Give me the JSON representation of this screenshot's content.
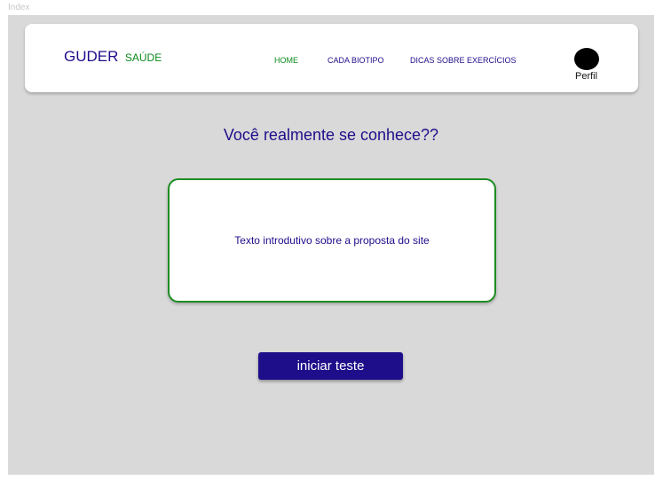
{
  "frame": {
    "label": "Index"
  },
  "header": {
    "brand": {
      "main": "GUDER",
      "sub": "SAÚDE"
    },
    "nav": [
      {
        "label": "HOME",
        "active": true
      },
      {
        "label": "CADA BIOTIPO",
        "active": false
      },
      {
        "label": "DICAS SOBRE EXERCÍCIOS",
        "active": false
      }
    ],
    "profile": {
      "label": "Perfil",
      "icon": "avatar-circle"
    }
  },
  "main": {
    "title": "Você realmente se conhece??",
    "intro": "Texto introdutivo sobre a proposta do site",
    "button_label": "iniciar teste"
  },
  "colors": {
    "primary": "#1f0e8a",
    "accent_green": "#0b8a1c",
    "background": "#d9d9d9",
    "card": "#ffffff"
  }
}
